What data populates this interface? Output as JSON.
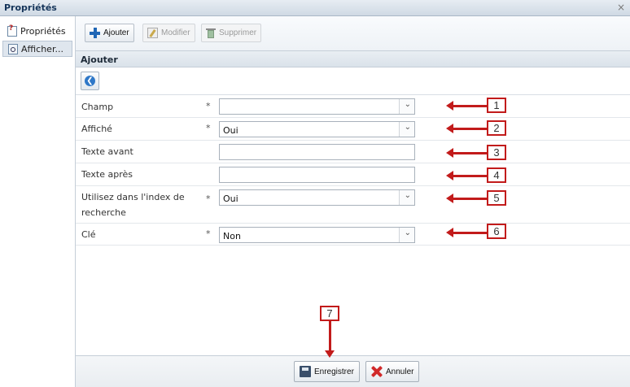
{
  "window": {
    "title": "Propriétés",
    "close_glyph": "×"
  },
  "sidebar": {
    "items": [
      {
        "label": "Propriétés",
        "icon": "properties-icon"
      },
      {
        "label": "Afficher...",
        "icon": "view-icon",
        "selected": true
      }
    ]
  },
  "toolbar": {
    "add_label": "Ajouter",
    "edit_label": "Modifier",
    "delete_label": "Supprimer"
  },
  "section": {
    "title": "Ajouter",
    "back_icon": "back-arrow-icon"
  },
  "form": {
    "required_mark": "*",
    "fields": [
      {
        "label": "Champ",
        "type": "select",
        "value": "",
        "required": true
      },
      {
        "label": "Affiché",
        "type": "select",
        "value": "Oui",
        "required": true
      },
      {
        "label": "Texte avant",
        "type": "text",
        "value": "",
        "required": false
      },
      {
        "label": "Texte après",
        "type": "text",
        "value": "",
        "required": false
      },
      {
        "label_line1": "Utilisez dans l'index de",
        "label_line2": "recherche",
        "type": "select",
        "value": "Oui",
        "required": true
      },
      {
        "label": "Clé",
        "type": "select",
        "value": "Non",
        "required": true
      }
    ]
  },
  "footer": {
    "save_label": "Enregistrer",
    "cancel_label": "Annuler"
  },
  "annotations": [
    "1",
    "2",
    "3",
    "4",
    "5",
    "6",
    "7"
  ],
  "colors": {
    "annotation": "#c21b1b",
    "accent": "#1f66b5"
  }
}
